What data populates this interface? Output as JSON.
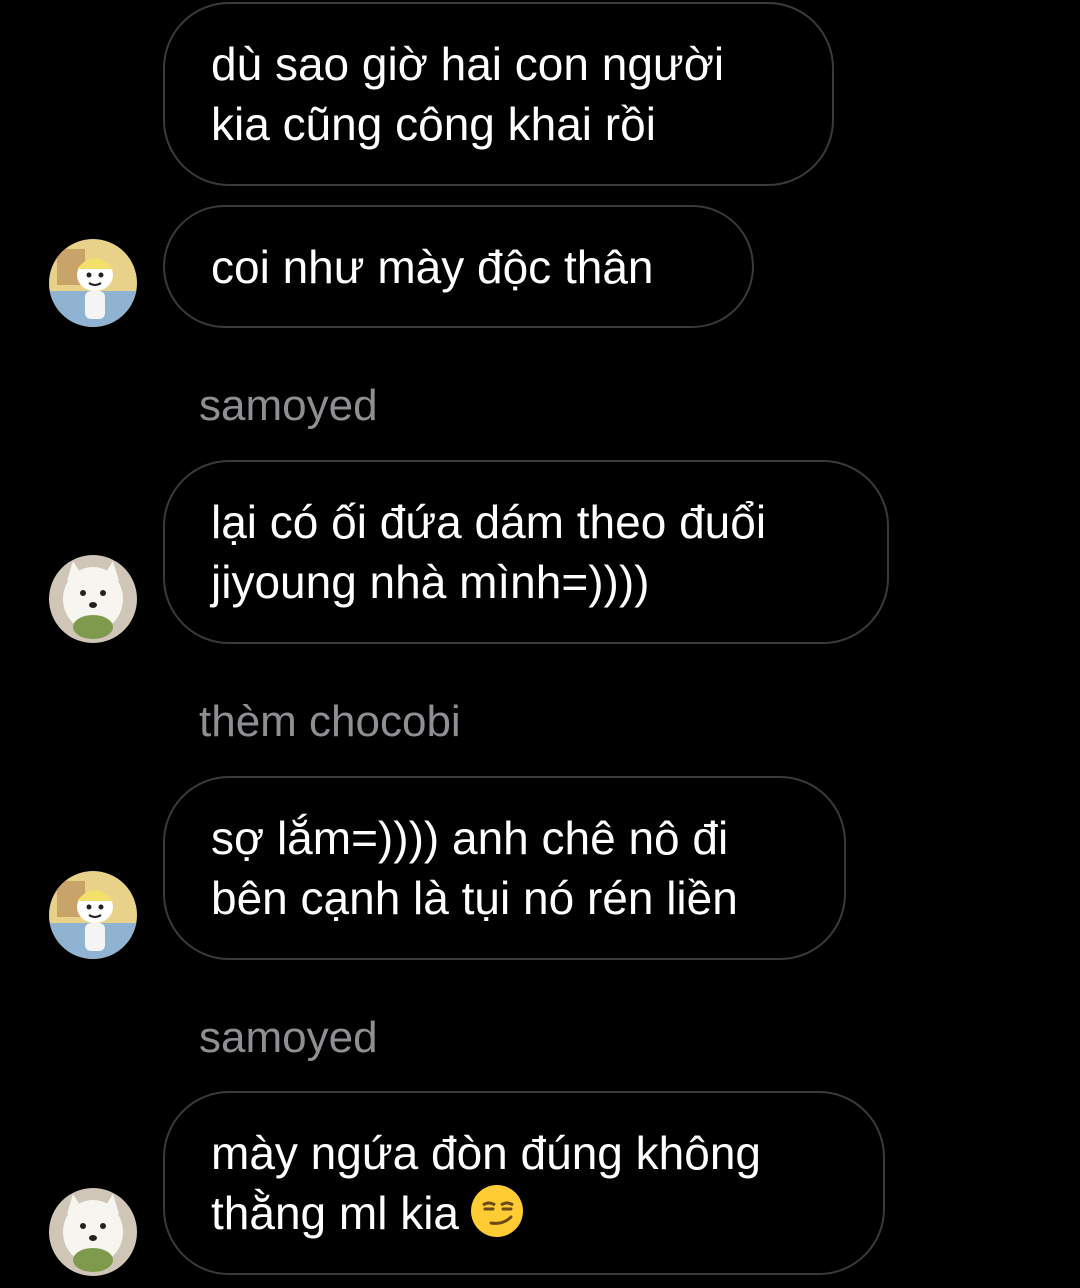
{
  "colors": {
    "background": "#000000",
    "bubble_border": "#3a3a3c",
    "message_text": "#ffffff",
    "sender_text": "#8e8e93"
  },
  "messages": [
    {
      "lines": [
        "dù sao giờ hai con người",
        "kia cũng công khai rồi"
      ]
    },
    {
      "lines": [
        "coi như mày độc thân"
      ],
      "avatar": "cartoon-avatar"
    },
    {
      "sender": "samoyed"
    },
    {
      "lines": [
        "lại có ối đứa dám theo đuổi",
        "jiyoung nhà mình=))))"
      ],
      "avatar": "samoyed-dog-avatar"
    },
    {
      "sender": "thèm chocobi"
    },
    {
      "lines": [
        "sợ lắm=)))) anh chê nô đi",
        "bên cạnh là tụi nó rén liền"
      ],
      "avatar": "cartoon-avatar"
    },
    {
      "sender": "samoyed"
    },
    {
      "lines": [
        "mày ngứa đòn đúng không",
        "thằng ml kia"
      ],
      "emoji": "smirking-face-emoji",
      "avatar": "samoyed-dog-avatar"
    }
  ]
}
